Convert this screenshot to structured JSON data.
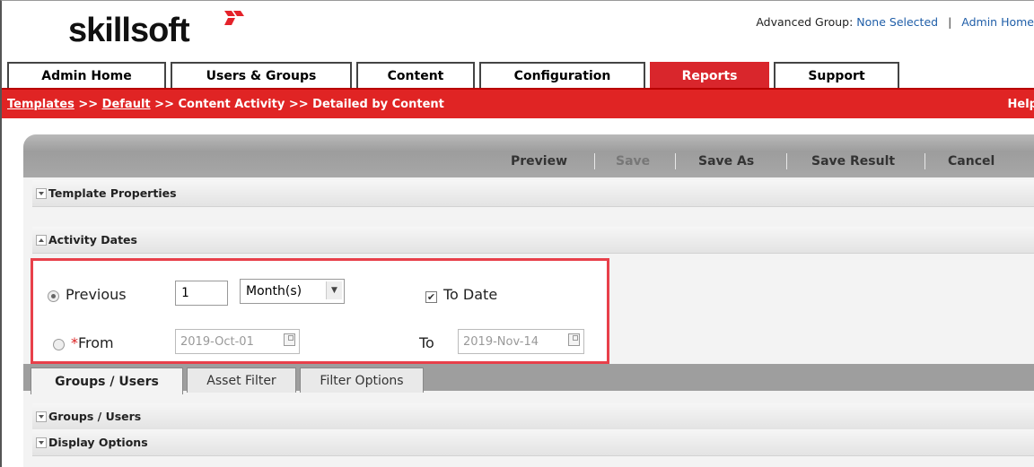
{
  "header": {
    "logo_text": "skillsoft",
    "advanced_group_label": "Advanced Group:",
    "advanced_group_value": "None Selected",
    "separator": "|",
    "admin_home_link": "Admin Home"
  },
  "tabs": [
    {
      "label": "Admin Home"
    },
    {
      "label": "Users & Groups"
    },
    {
      "label": "Content"
    },
    {
      "label": "Configuration"
    },
    {
      "label": "Reports",
      "active": true
    },
    {
      "label": "Support"
    }
  ],
  "breadcrumb": {
    "item1": "Templates",
    "sep": ">>",
    "item2": "Default",
    "item3": "Content Activity",
    "item4": "Detailed by Content",
    "help": "Help"
  },
  "toolbar": {
    "preview": "Preview",
    "save": "Save",
    "save_as": "Save As",
    "save_result": "Save Result",
    "cancel": "Cancel"
  },
  "sections": {
    "template_properties": "Template Properties",
    "activity_dates": "Activity Dates",
    "groups_users": "Groups / Users",
    "display_options": "Display Options"
  },
  "activity_dates": {
    "previous_label": "Previous",
    "previous_value": "1",
    "period_selected": "Month(s)",
    "to_date_label": "To Date",
    "to_date_checked": true,
    "from_required_mark": "*",
    "from_label": "From",
    "from_value": "2019-Oct-01",
    "to_label": "To",
    "to_value": "2019-Nov-14"
  },
  "subtabs": [
    {
      "label": "Groups / Users",
      "active": true
    },
    {
      "label": "Asset Filter"
    },
    {
      "label": "Filter Options"
    }
  ],
  "colors": {
    "brand_red": "#d9262c",
    "highlight_border": "#e8404a",
    "link_blue": "#1f5ea8"
  }
}
